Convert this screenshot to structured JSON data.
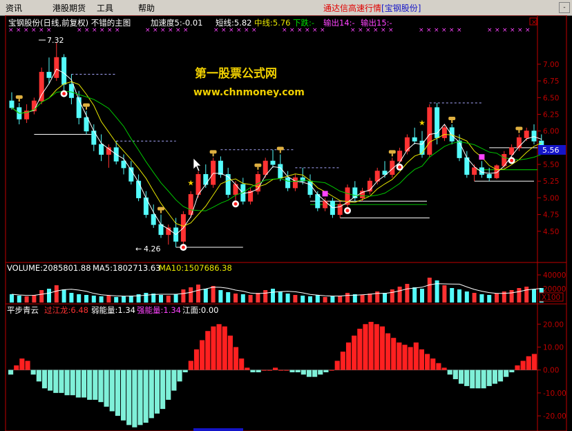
{
  "menu": {
    "items": [
      "资讯",
      "港股期货",
      "工具",
      "帮助"
    ],
    "app_title": "通达信高速行情",
    "app_stock": "[宝钢股份]",
    "min_btn": "-"
  },
  "main": {
    "title": "宝钢股份(日线,前复权) 不错的主图",
    "accel_label": "加速度5:-0.01",
    "short_label": "短线:5.82",
    "mid_label": "中线:5.76",
    "trend_label": "下跌:-",
    "out14_label": "输出14:-",
    "out15_label": "输出15:-",
    "close_btn": "×",
    "watermark_cn": "第一股票公式网",
    "watermark_url": "www.chnmoney.com",
    "high_label": "7.32",
    "low_label": "4.26",
    "price_box": "5.56",
    "colors": {
      "up": "#ff3232",
      "down": "#54fcfc",
      "short": "#ffffff",
      "mid": "#e8e800",
      "long": "#00c800",
      "axis": "#c00000"
    }
  },
  "volume": {
    "label": "VOLUME:2085801.88",
    "ma5_label": "MA5:1802713.63",
    "ma10_label": "MA10:1507686.38",
    "scale_label": "X100"
  },
  "indicator": {
    "name": "平步青云",
    "l1": "过江龙:6.48",
    "l2": "弱能量:1.34",
    "l3": "强能量:1.34",
    "l4": "江面:0.00"
  },
  "chart_data": {
    "type": "candlestick",
    "price_axis_ticks": [
      "7.00",
      "6.75",
      "6.50",
      "6.25",
      "6.00",
      "5.75",
      "5.50",
      "5.25",
      "5.00",
      "4.75",
      "4.50"
    ],
    "price_ylim": [
      4.26,
      7.32
    ],
    "volume_axis_ticks": [
      "40000",
      "20000"
    ],
    "indicator_axis_ticks": [
      "20.00",
      "10.00",
      "0.00",
      "-10.00",
      "-20.00"
    ],
    "indicator_ylim": [
      -26,
      24
    ],
    "candles": [
      [
        6.45,
        6.58,
        6.32,
        6.35
      ],
      [
        6.35,
        6.42,
        6.1,
        6.18
      ],
      [
        6.18,
        6.4,
        6.12,
        6.3
      ],
      [
        6.3,
        6.5,
        6.25,
        6.45
      ],
      [
        6.45,
        6.95,
        6.4,
        6.88
      ],
      [
        6.88,
        7.1,
        6.7,
        6.8
      ],
      [
        6.8,
        7.32,
        6.75,
        7.1
      ],
      [
        7.1,
        7.15,
        6.6,
        6.7
      ],
      [
        6.7,
        6.85,
        6.4,
        6.5
      ],
      [
        6.5,
        6.6,
        6.1,
        6.2
      ],
      [
        6.2,
        6.3,
        5.95,
        6.0
      ],
      [
        6.0,
        6.1,
        5.7,
        5.8
      ],
      [
        5.8,
        5.95,
        5.55,
        5.65
      ],
      [
        5.65,
        5.8,
        5.45,
        5.75
      ],
      [
        5.75,
        5.85,
        5.5,
        5.55
      ],
      [
        5.55,
        5.65,
        5.35,
        5.45
      ],
      [
        5.45,
        5.55,
        5.2,
        5.25
      ],
      [
        5.25,
        5.35,
        4.95,
        5.0
      ],
      [
        5.0,
        5.1,
        4.7,
        4.75
      ],
      [
        4.75,
        4.9,
        4.55,
        4.6
      ],
      [
        4.6,
        4.75,
        4.4,
        4.45
      ],
      [
        4.45,
        4.6,
        4.3,
        4.55
      ],
      [
        4.55,
        4.7,
        4.26,
        4.35
      ],
      [
        4.35,
        4.8,
        4.3,
        4.75
      ],
      [
        4.75,
        5.1,
        4.7,
        5.05
      ],
      [
        5.05,
        5.4,
        5.0,
        5.35
      ],
      [
        5.35,
        5.5,
        5.15,
        5.2
      ],
      [
        5.2,
        5.6,
        5.15,
        5.55
      ],
      [
        5.55,
        5.62,
        5.3,
        5.35
      ],
      [
        5.35,
        5.45,
        5.0,
        5.05
      ],
      [
        5.05,
        5.25,
        4.95,
        5.2
      ],
      [
        5.2,
        5.3,
        4.9,
        4.95
      ],
      [
        4.95,
        5.15,
        4.9,
        5.1
      ],
      [
        5.1,
        5.4,
        5.05,
        5.35
      ],
      [
        5.35,
        5.6,
        5.3,
        5.55
      ],
      [
        5.55,
        5.72,
        5.45,
        5.5
      ],
      [
        5.5,
        5.65,
        5.25,
        5.3
      ],
      [
        5.3,
        5.4,
        5.1,
        5.15
      ],
      [
        5.15,
        5.35,
        5.1,
        5.3
      ],
      [
        5.3,
        5.45,
        5.2,
        5.25
      ],
      [
        5.25,
        5.35,
        5.0,
        5.05
      ],
      [
        5.05,
        5.1,
        4.8,
        4.85
      ],
      [
        4.85,
        5.0,
        4.8,
        4.95
      ],
      [
        4.95,
        5.0,
        4.7,
        4.75
      ],
      [
        4.75,
        4.95,
        4.7,
        4.9
      ],
      [
        4.9,
        5.2,
        4.85,
        5.15
      ],
      [
        5.15,
        5.25,
        4.95,
        5.0
      ],
      [
        5.0,
        5.15,
        4.95,
        5.1
      ],
      [
        5.1,
        5.3,
        5.05,
        5.25
      ],
      [
        5.25,
        5.45,
        5.2,
        5.4
      ],
      [
        5.4,
        5.55,
        5.3,
        5.35
      ],
      [
        5.35,
        5.6,
        5.3,
        5.55
      ],
      [
        5.55,
        5.75,
        5.5,
        5.7
      ],
      [
        5.7,
        5.95,
        5.65,
        5.9
      ],
      [
        5.9,
        6.05,
        5.8,
        5.85
      ],
      [
        5.85,
        6.0,
        5.6,
        5.65
      ],
      [
        5.65,
        6.4,
        5.6,
        6.35
      ],
      [
        6.35,
        6.42,
        5.8,
        5.9
      ],
      [
        5.9,
        6.1,
        5.85,
        6.05
      ],
      [
        6.05,
        6.1,
        5.8,
        5.85
      ],
      [
        5.85,
        5.95,
        5.55,
        5.6
      ],
      [
        5.6,
        5.7,
        5.3,
        5.35
      ],
      [
        5.35,
        5.5,
        5.25,
        5.45
      ],
      [
        5.45,
        5.55,
        5.3,
        5.35
      ],
      [
        5.35,
        5.45,
        5.25,
        5.3
      ],
      [
        5.3,
        5.5,
        5.28,
        5.48
      ],
      [
        5.48,
        5.7,
        5.45,
        5.65
      ],
      [
        5.65,
        5.8,
        5.6,
        5.75
      ],
      [
        5.75,
        5.95,
        5.7,
        5.9
      ],
      [
        5.9,
        6.05,
        5.85,
        6.0
      ],
      [
        6.0,
        6.1,
        5.8,
        5.85
      ],
      [
        5.85,
        5.95,
        5.7,
        5.78
      ]
    ],
    "volumes": [
      1.2,
      1.0,
      0.9,
      1.1,
      1.8,
      2.0,
      2.5,
      1.9,
      1.4,
      1.2,
      1.1,
      1.0,
      0.9,
      1.0,
      0.8,
      0.9,
      1.0,
      1.2,
      1.4,
      1.3,
      1.1,
      1.0,
      1.2,
      1.9,
      2.2,
      2.6,
      2.0,
      2.4,
      1.8,
      1.5,
      1.3,
      1.2,
      1.1,
      1.4,
      1.8,
      2.0,
      1.6,
      1.3,
      1.1,
      1.0,
      0.9,
      1.1,
      0.8,
      0.9,
      1.0,
      1.4,
      1.2,
      1.1,
      1.3,
      1.6,
      1.4,
      1.9,
      2.3,
      2.7,
      2.2,
      2.0,
      3.6,
      3.2,
      2.5,
      2.1,
      1.9,
      1.6,
      1.4,
      1.2,
      1.1,
      1.3,
      1.6,
      1.8,
      2.1,
      2.3,
      1.9,
      2.1
    ],
    "indicator": [
      -2,
      2,
      5,
      4,
      -2,
      -5,
      -8,
      -9,
      -10,
      -10,
      -11,
      -11,
      -12,
      -12,
      -13,
      -13,
      -14,
      -16,
      -18,
      -20,
      -22,
      -24,
      -25,
      -24,
      -23,
      -21,
      -19,
      -17,
      -13,
      -9,
      -5,
      -1,
      4,
      9,
      13,
      17,
      19,
      20,
      19,
      15,
      10,
      5,
      1,
      -1,
      -1,
      0,
      0,
      1,
      0,
      0,
      -1,
      -1,
      -2,
      -3,
      -3,
      -2,
      -1,
      0,
      4,
      8,
      12,
      15,
      18,
      20,
      21,
      20,
      19,
      16,
      14,
      12,
      11,
      10
    ],
    "indicator_tail": [
      12,
      9,
      7,
      5,
      3,
      1,
      -2,
      -4,
      -6,
      -7,
      -8,
      -8,
      -8,
      -7,
      -6,
      -5,
      -3,
      -1,
      2,
      4,
      6,
      7
    ]
  }
}
